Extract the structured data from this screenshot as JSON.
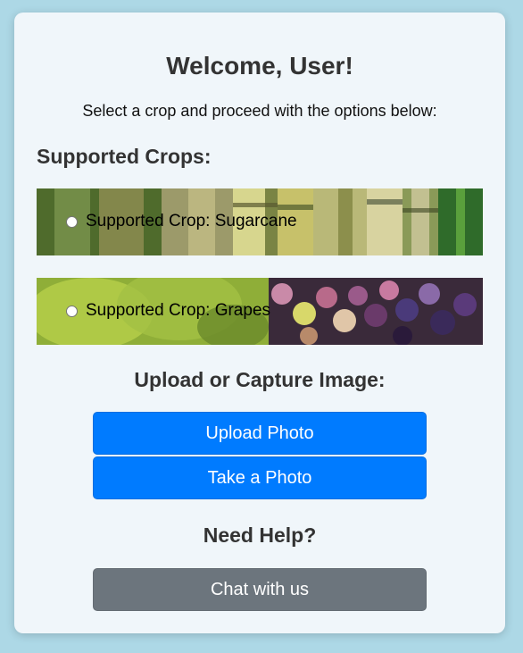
{
  "header": {
    "title": "Welcome, User!",
    "subtitle": "Select a crop and proceed with the options below:"
  },
  "crops": {
    "section_title": "Supported Crops:",
    "items": [
      {
        "label": "Supported Crop: Sugarcane",
        "selected": false
      },
      {
        "label": "Supported Crop: Grapes",
        "selected": false
      }
    ]
  },
  "upload": {
    "section_title": "Upload or Capture Image:",
    "upload_label": "Upload Photo",
    "capture_label": "Take a Photo"
  },
  "help": {
    "section_title": "Need Help?",
    "chat_label": "Chat with us"
  },
  "colors": {
    "page_background": "#add8e6",
    "card_background": "#f0f6fa",
    "primary_button": "#007bff",
    "secondary_button": "#6c757d"
  }
}
